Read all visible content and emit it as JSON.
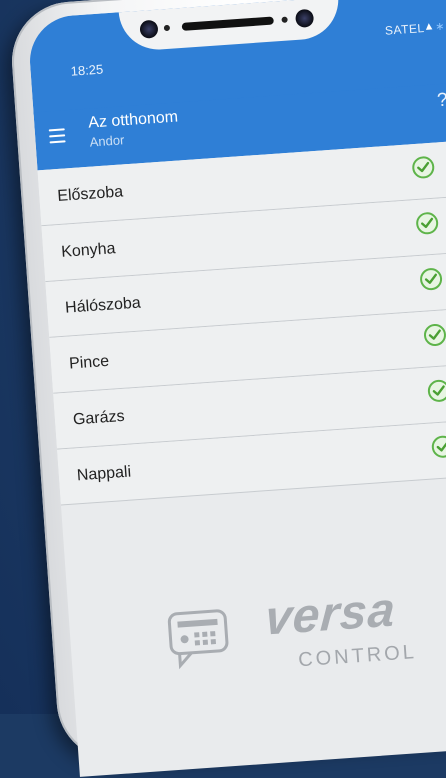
{
  "status_bar": {
    "time": "18:25",
    "carrier": "SATEL"
  },
  "app_bar": {
    "title": "Az otthonom",
    "subtitle": "Andor",
    "help": "?"
  },
  "zones": [
    {
      "name": "Előszoba"
    },
    {
      "name": "Konyha"
    },
    {
      "name": "Hálószoba"
    },
    {
      "name": "Pince"
    },
    {
      "name": "Garázs"
    },
    {
      "name": "Nappali"
    }
  ],
  "branding": {
    "brand": "versa",
    "product": "CONTROL"
  },
  "colors": {
    "primary": "#2f7fd6",
    "ok": "#5eb44a",
    "background": "#1c3a63"
  }
}
